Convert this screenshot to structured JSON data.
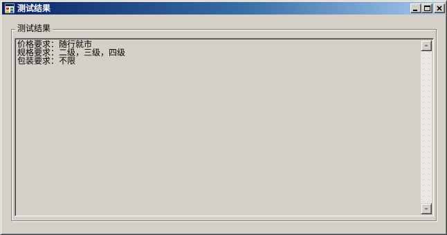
{
  "window": {
    "title": "测试结果",
    "icon": "app-window-icon",
    "caption_buttons": [
      "minimize-icon",
      "maximize-icon",
      "close-icon"
    ]
  },
  "group": {
    "label": "测试结果"
  },
  "results": {
    "lines": [
      "价格要求：随行就市",
      "规格要求：二级，三级，四级",
      "包装要求：不限"
    ]
  },
  "scrollbar": {
    "up_icon": "arrow-up-icon",
    "down_icon": "arrow-down-icon"
  }
}
